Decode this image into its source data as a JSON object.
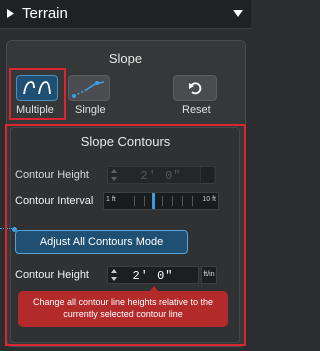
{
  "header": {
    "title": "Terrain",
    "back_icon": "triangle-right-icon",
    "collapse_icon": "chevron-down-icon"
  },
  "slope": {
    "title": "Slope",
    "tools": [
      {
        "label": "Multiple",
        "icon": "multiple-slope-icon",
        "selected": true
      },
      {
        "label": "Single",
        "icon": "single-slope-icon",
        "selected": false
      },
      {
        "label": "Reset",
        "icon": "reset-icon",
        "selected": false
      }
    ]
  },
  "contours": {
    "title": "Slope Contours",
    "height_label": "Contour Height",
    "height_value": "2' 0\"",
    "interval_label": "Contour Interval",
    "interval_min": "1 ft",
    "interval_max": "10 ft",
    "interval_value": 5,
    "mode_button": "Adjust All Contours Mode",
    "mode_height_label": "Contour Height",
    "mode_height_value": "2' 0\"",
    "mode_height_unit": "ft/in",
    "tooltip": "Change all contour line heights relative to the currently selected contour line"
  },
  "colors": {
    "accent": "#1f4f73",
    "highlight": "#d9262f",
    "tooltip": "#b32a2a"
  }
}
